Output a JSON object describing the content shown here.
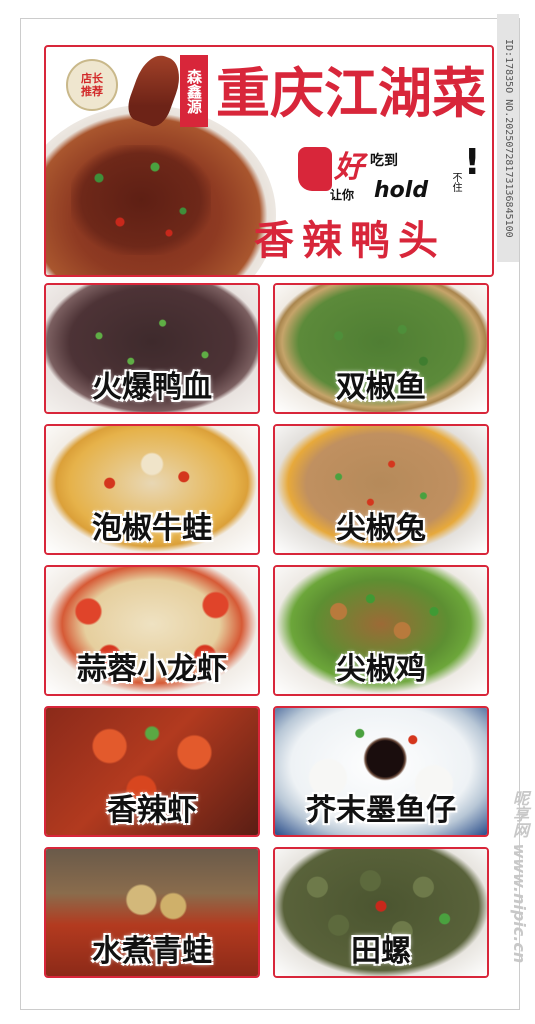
{
  "header": {
    "badge": "店长推荐",
    "brand_seal": "森鑫源",
    "title": "重庆江湖菜",
    "featured_dish": "香辣鸭头",
    "slogan": {
      "hao": "好",
      "chidao": "吃到",
      "rangni": "让你",
      "hold": "hold",
      "buzhu": "不住",
      "excl": "!"
    }
  },
  "dishes": [
    {
      "name": "火爆鸭血"
    },
    {
      "name": "双椒鱼"
    },
    {
      "name": "泡椒牛蛙"
    },
    {
      "name": "尖椒兔"
    },
    {
      "name": "蒜蓉小龙虾"
    },
    {
      "name": "尖椒鸡"
    },
    {
      "name": "香辣虾"
    },
    {
      "name": "芥末墨鱼仔"
    },
    {
      "name": "水煮青蛙"
    },
    {
      "name": "田螺"
    }
  ],
  "watermark": {
    "id": "ID:17835O NO.20250728173136845100",
    "site": "昵享网 www.nipic.cn"
  },
  "colors": {
    "accent": "#d8263a",
    "text": "#111111"
  }
}
